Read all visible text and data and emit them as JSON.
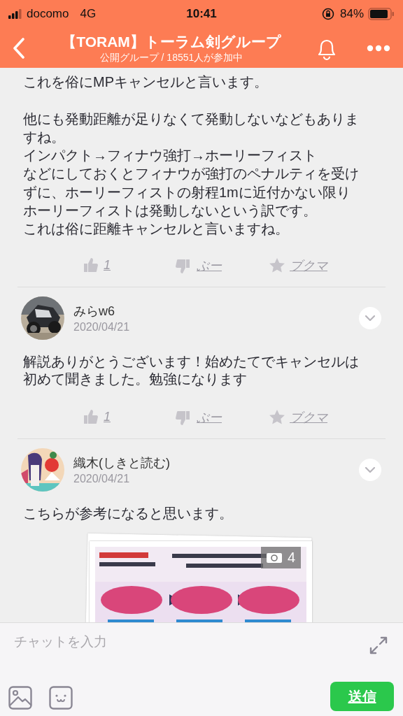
{
  "status_bar": {
    "carrier": "docomo",
    "network": "4G",
    "time": "10:41",
    "battery": "84%"
  },
  "header": {
    "title": "【TORAM】トーラム剣グループ",
    "subtitle": "公開グループ / 18551人が参加中"
  },
  "post": {
    "paragraphs": [
      {
        "lines": [
          "これを俗にMPキャンセルと言います。"
        ]
      },
      {
        "lines": [
          "他にも発動距離が足りなくて発動しないなどもありますね。",
          "インパクト→フィナウ強打→ホーリーフィスト",
          "などにしておくとフィナウが強打のペナルティを受けずに、ホーリーフィストの射程1mに近付かない限りホーリーフィストは発動しないという訳です。",
          "これは俗に距離キャンセルと言いますね。"
        ]
      }
    ],
    "reactions": {
      "likes": "1",
      "dislike": "ぶー",
      "bookmark": "ブクマ"
    }
  },
  "comments": [
    {
      "author": "みらw6",
      "date": "2020/04/21",
      "text": "解説ありがとうございます！始めたてでキャンセルは初めて聞きました。勉強になります",
      "reactions": {
        "likes": "1",
        "dislike": "ぶー",
        "bookmark": "ブクマ"
      }
    },
    {
      "author": "織木(しきと読む)",
      "date": "2020/04/21",
      "text": "こちらが参考になると思います。",
      "attachment": {
        "kind": "picture",
        "count": "4"
      }
    }
  ],
  "composer": {
    "placeholder": "チャットを入力",
    "send": "送信"
  }
}
